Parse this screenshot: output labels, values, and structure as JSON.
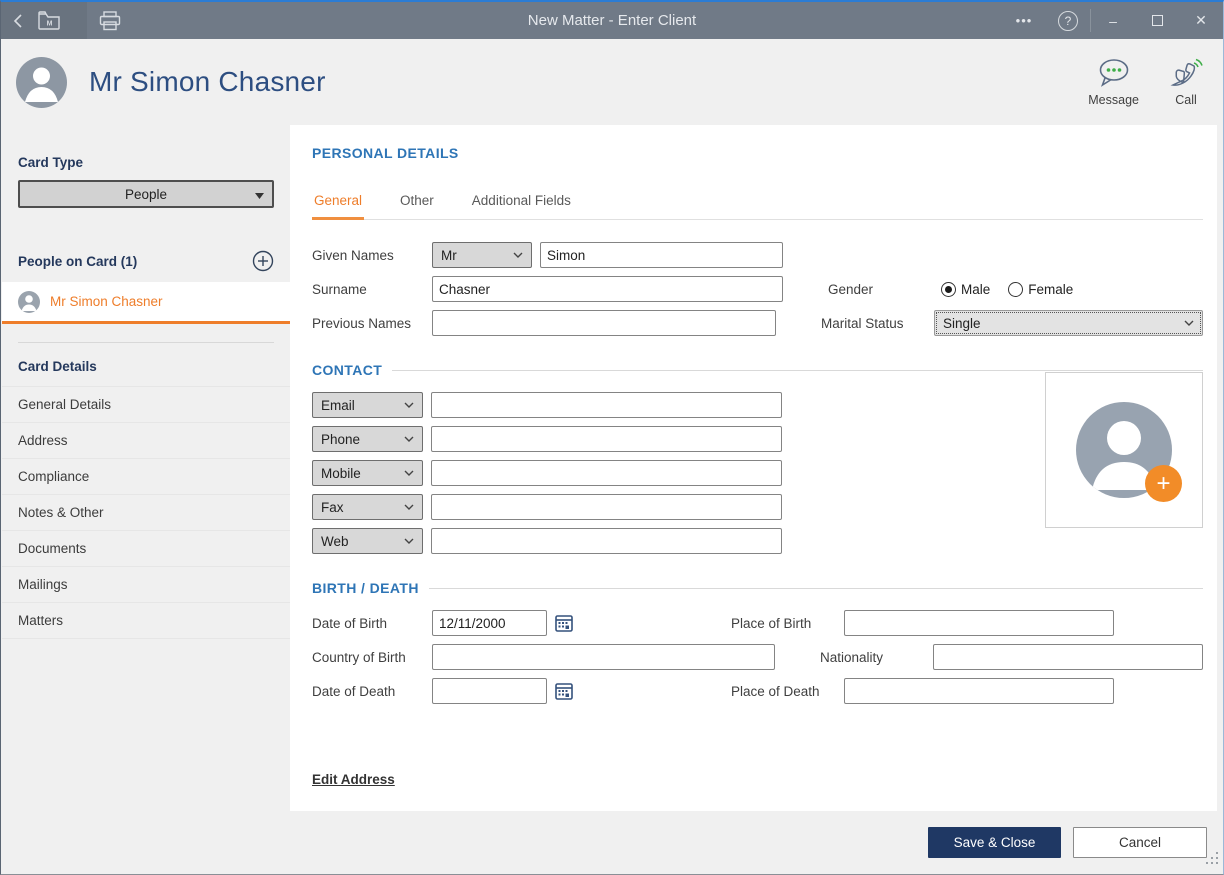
{
  "titlebar": {
    "title": "New Matter - Enter Client",
    "controls": {
      "more": "•••",
      "help": "?",
      "minimize": "–",
      "close": "✕"
    }
  },
  "header": {
    "name": "Mr Simon Chasner",
    "message_label": "Message",
    "call_label": "Call"
  },
  "sidebar": {
    "card_type_label": "Card Type",
    "card_type_value": "People",
    "people_header": "People on Card (1)",
    "person_name": "Mr Simon Chasner",
    "card_details_label": "Card Details",
    "items": [
      {
        "label": "General Details"
      },
      {
        "label": "Address"
      },
      {
        "label": "Compliance"
      },
      {
        "label": "Notes & Other"
      },
      {
        "label": "Documents"
      },
      {
        "label": "Mailings"
      },
      {
        "label": "Matters"
      }
    ]
  },
  "main": {
    "section_personal": "PERSONAL DETAILS",
    "tabs": [
      {
        "label": "General",
        "active": true
      },
      {
        "label": "Other",
        "active": false
      },
      {
        "label": "Additional Fields",
        "active": false
      }
    ],
    "fields": {
      "given_names_label": "Given Names",
      "title_value": "Mr",
      "given_names_value": "Simon",
      "surname_label": "Surname",
      "surname_value": "Chasner",
      "previous_names_label": "Previous Names",
      "previous_names_value": "",
      "gender_label": "Gender",
      "gender_male": "Male",
      "gender_female": "Female",
      "gender_selected": "Male",
      "marital_label": "Marital Status",
      "marital_value": "Single"
    },
    "contact": {
      "heading": "CONTACT",
      "rows": [
        {
          "type": "Email",
          "value": ""
        },
        {
          "type": "Phone",
          "value": ""
        },
        {
          "type": "Mobile",
          "value": ""
        },
        {
          "type": "Fax",
          "value": ""
        },
        {
          "type": "Web",
          "value": ""
        }
      ]
    },
    "birth_death": {
      "heading": "BIRTH / DEATH",
      "dob_label": "Date of Birth",
      "dob_value": "12/11/2000",
      "country_of_birth_label": "Country of Birth",
      "country_of_birth_value": "",
      "dod_label": "Date of Death",
      "dod_value": "",
      "place_of_birth_label": "Place of Birth",
      "place_of_birth_value": "",
      "nationality_label": "Nationality",
      "nationality_value": "",
      "place_of_death_label": "Place of Death",
      "place_of_death_value": ""
    },
    "edit_address_label": "Edit Address"
  },
  "footer": {
    "save_label": "Save & Close",
    "cancel_label": "Cancel"
  },
  "colors": {
    "accent_orange": "#ee7d2a",
    "heading_blue": "#2e75b6",
    "navy": "#1f3864",
    "titlebar_gray": "#707a87"
  }
}
